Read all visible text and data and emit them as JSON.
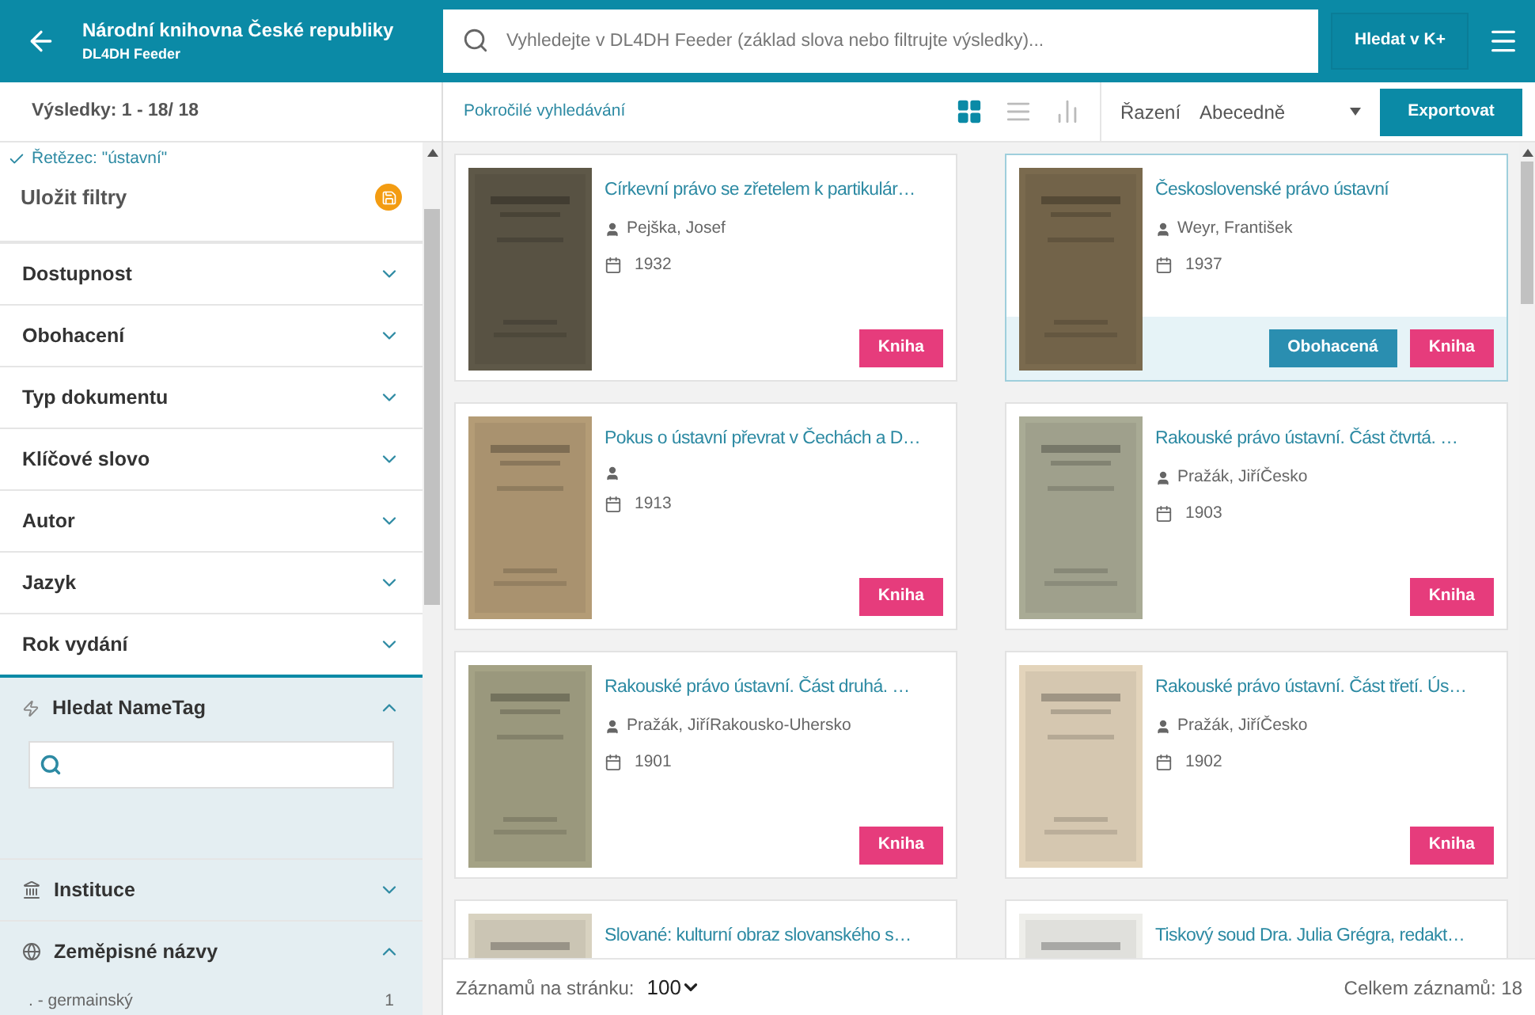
{
  "header": {
    "title": "Národní knihovna České republiky",
    "subtitle": "DL4DH Feeder",
    "search_placeholder": "Vyhledejte v DL4DH Feeder (základ slova nebo filtrujte výsledky)...",
    "search_button": "Hledat v K+"
  },
  "sidebar": {
    "results": "Výsledky: 1 - 18/ 18",
    "active_filter": "Řetězec: \"ústavní\"",
    "save_filters": "Uložit filtry",
    "filters": [
      {
        "label": "Dostupnost",
        "expanded": false,
        "kind": "plain"
      },
      {
        "label": "Obohacení",
        "expanded": false,
        "kind": "plain"
      },
      {
        "label": "Typ dokumentu",
        "expanded": false,
        "kind": "plain"
      },
      {
        "label": "Klíčové slovo",
        "expanded": false,
        "kind": "plain"
      },
      {
        "label": "Autor",
        "expanded": false,
        "kind": "plain"
      },
      {
        "label": "Jazyk",
        "expanded": false,
        "kind": "plain"
      },
      {
        "label": "Rok vydání",
        "expanded": false,
        "kind": "plain"
      },
      {
        "label": "Hledat NameTag",
        "expanded": true,
        "kind": "nametag"
      },
      {
        "label": "Instituce",
        "expanded": false,
        "kind": "institution"
      },
      {
        "label": "Zeměpisné názvy",
        "expanded": true,
        "kind": "places",
        "items": [
          {
            "label": ". - germainský",
            "count": "1"
          }
        ]
      }
    ]
  },
  "toolbar": {
    "advanced_search": "Pokročilé vyhledávání",
    "views": [
      {
        "kind": "grid",
        "selected": true
      },
      {
        "kind": "list",
        "selected": false
      },
      {
        "kind": "chart",
        "selected": false
      }
    ],
    "sort_label": "Řazení",
    "sort_value": "Abecedně",
    "export": "Exportovat"
  },
  "cards": [
    {
      "title": "Církevní právo se zřetelem k partikulár…",
      "author": "Pejška, Josef",
      "year": "1932",
      "highlighted": false,
      "tags": [
        {
          "label": "Kniha",
          "kind": "type"
        }
      ]
    },
    {
      "title": "Československé právo ústavní",
      "author": "Weyr, František",
      "year": "1937",
      "highlighted": true,
      "tags": [
        {
          "label": "Obohacená",
          "kind": "enriched"
        },
        {
          "label": "Kniha",
          "kind": "type"
        }
      ]
    },
    {
      "title": "Pokus o ústavní převrat v Čechách a D…",
      "year": "1913",
      "highlighted": false,
      "tags": [
        {
          "label": "Kniha",
          "kind": "type"
        }
      ]
    },
    {
      "title": "Rakouské právo ústavní. Část čtvrtá. …",
      "author": "Pražák, JiříČesko",
      "year": "1903",
      "highlighted": false,
      "tags": [
        {
          "label": "Kniha",
          "kind": "type"
        }
      ]
    },
    {
      "title": "Rakouské právo ústavní. Část druhá. …",
      "author": "Pražák, JiříRakousko-Uhersko",
      "year": "1901",
      "highlighted": false,
      "tags": [
        {
          "label": "Kniha",
          "kind": "type"
        }
      ]
    },
    {
      "title": "Rakouské právo ústavní. Část třetí. Ús…",
      "author": "Pražák, JiříČesko",
      "year": "1902",
      "highlighted": false,
      "tags": [
        {
          "label": "Kniha",
          "kind": "type"
        }
      ]
    },
    {
      "title": "Slované: kulturní obraz slovanského s…",
      "highlighted": false
    },
    {
      "title": "Tiskový soud Dra. Julia Grégra, redakt…",
      "highlighted": false
    }
  ],
  "footer": {
    "per_page_label": "Záznamů na stránku:",
    "per_page": "100",
    "total": "Celkem záznamů: 18"
  }
}
